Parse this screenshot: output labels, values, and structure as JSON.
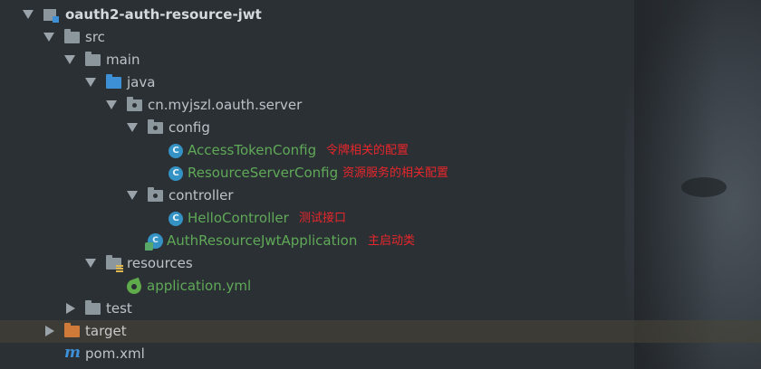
{
  "tree": {
    "root": {
      "label": "oauth2-auth-resource-jwt",
      "icon": "module-folder-icon"
    },
    "src": {
      "label": "src",
      "icon": "folder-icon"
    },
    "main": {
      "label": "main",
      "icon": "folder-icon"
    },
    "java": {
      "label": "java",
      "icon": "source-folder-icon"
    },
    "package": {
      "label": "cn.myjszl.oauth.server",
      "icon": "package-icon"
    },
    "config": {
      "label": "config",
      "icon": "package-icon"
    },
    "access_token_config": {
      "label": "AccessTokenConfig",
      "icon": "java-class-icon",
      "note": "令牌相关的配置"
    },
    "resource_server_config": {
      "label": "ResourceServerConfig",
      "icon": "java-class-icon",
      "note": "资源服务的相关配置"
    },
    "controller": {
      "label": "controller",
      "icon": "package-icon"
    },
    "hello_controller": {
      "label": "HelloController",
      "icon": "java-class-icon",
      "note": "测试接口"
    },
    "application": {
      "label": "AuthResourceJwtApplication",
      "icon": "spring-boot-app-icon",
      "note": "主启动类"
    },
    "resources": {
      "label": "resources",
      "icon": "resources-folder-icon"
    },
    "application_yml": {
      "label": "application.yml",
      "icon": "spring-yml-icon"
    },
    "test": {
      "label": "test",
      "icon": "folder-icon"
    },
    "target": {
      "label": "target",
      "icon": "excluded-folder-icon"
    },
    "pom": {
      "label": "pom.xml",
      "icon": "maven-icon"
    }
  },
  "glyphs": {
    "class_letter": "C",
    "maven_letter": "m"
  },
  "colors": {
    "background": "#2b3035",
    "note_red": "#e8262b",
    "class_green": "#5fa957",
    "folder_blue": "#3d8fd6",
    "target_orange": "#d07a3a",
    "selected_row": "#4b4637"
  }
}
